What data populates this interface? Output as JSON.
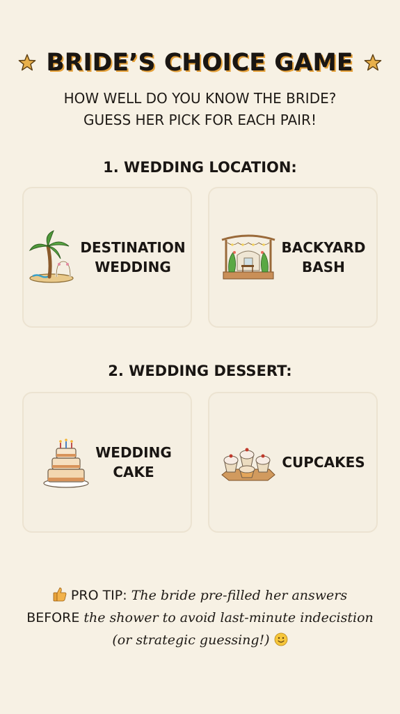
{
  "header": {
    "title": "BRIDE’S CHOICE GAME",
    "subtitle_line1": "HOW WELL DO YOU KNOW THE BRIDE?",
    "subtitle_line2": "GUESS HER PICK FOR EACH PAIR!"
  },
  "sections": [
    {
      "title": "1. WEDDING LOCATION:",
      "options": [
        {
          "label": "DESTINATION\nWEDDING",
          "icon": "palm-beach-icon"
        },
        {
          "label": "BACKYARD\nBASH",
          "icon": "backyard-pergola-icon"
        }
      ]
    },
    {
      "title": "2. WEDDING DESSERT:",
      "options": [
        {
          "label": "WEDDING\nCAKE",
          "icon": "wedding-cake-icon"
        },
        {
          "label": "CUPCAKES",
          "icon": "cupcakes-icon"
        }
      ]
    }
  ],
  "tip": {
    "lead": "PRO TIP:",
    "text1": " The bride pre-filled her answers",
    "caps": "BEFORE",
    "text2": " the shower to avoid last-minute indecistion",
    "text3": "(or strategic guessing!) "
  },
  "colors": {
    "background": "#f7f1e4",
    "accent": "#e5a13a",
    "card": "#f5efe2"
  }
}
